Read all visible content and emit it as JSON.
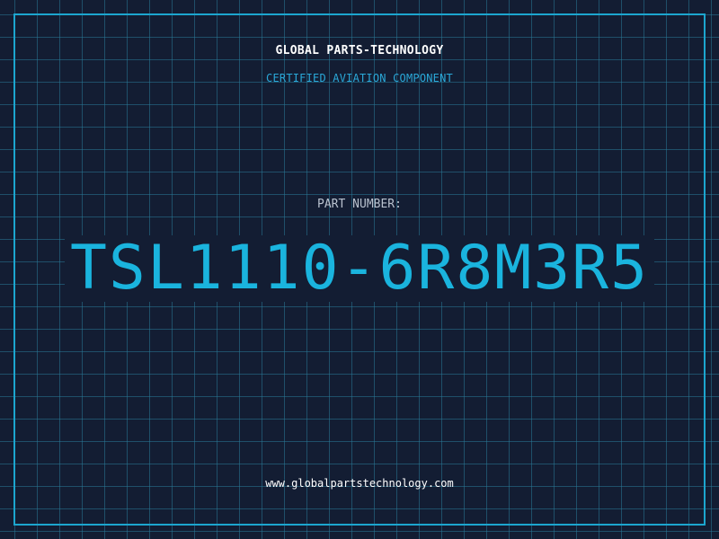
{
  "header": {
    "company": "GLOBAL PARTS-TECHNOLOGY",
    "subtitle": "CERTIFIED AVIATION COMPONENT"
  },
  "part": {
    "label": "PART NUMBER:",
    "number": "TSL1110-6R8M3R5"
  },
  "footer": {
    "url": "www.globalpartstechnology.com"
  },
  "colors": {
    "background": "#131d33",
    "grid": "#28789a",
    "frame": "#1ca6cf",
    "part_number": "#1ab4de",
    "subtitle": "#2aa8d8"
  }
}
